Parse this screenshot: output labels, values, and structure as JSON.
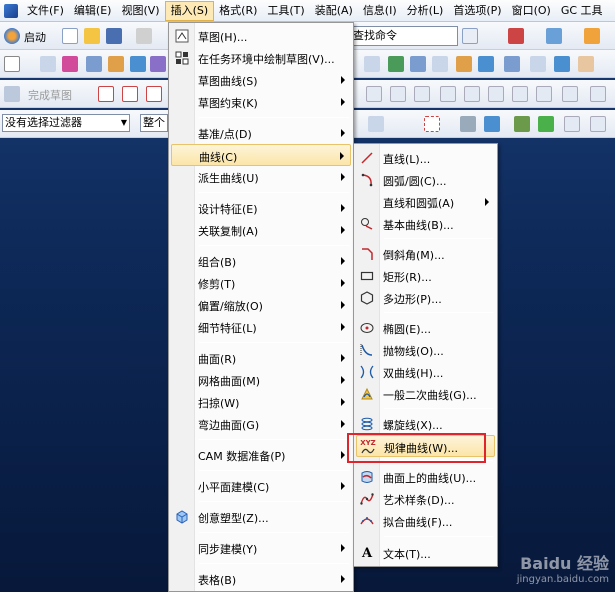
{
  "menubar": {
    "items": [
      "文件(F)",
      "编辑(E)",
      "视图(V)",
      "插入(S)",
      "格式(R)",
      "工具(T)",
      "装配(A)",
      "信息(I)",
      "分析(L)",
      "首选项(P)",
      "窗口(O)",
      "GC 工具"
    ]
  },
  "toolbar": {
    "start_label": "启动",
    "search_value": "查找命令",
    "finish_sketch_label": "完成草图",
    "selection_filter": "没有选择过滤器",
    "scope_value": "整个"
  },
  "insert_menu": {
    "items": [
      {
        "label": "草图(H)...",
        "icon": "sketch-icon",
        "submenu": false
      },
      {
        "label": "在任务环境中绘制草图(V)...",
        "icon": "sketch-task-icon",
        "submenu": false
      },
      {
        "label": "草图曲线(S)",
        "icon": "",
        "submenu": true
      },
      {
        "label": "草图约束(K)",
        "icon": "",
        "submenu": true
      },
      {
        "label": "基准/点(D)",
        "icon": "",
        "submenu": true
      },
      {
        "label": "曲线(C)",
        "icon": "",
        "submenu": true
      },
      {
        "label": "派生曲线(U)",
        "icon": "",
        "submenu": true
      },
      {
        "label": "设计特征(E)",
        "icon": "",
        "submenu": true
      },
      {
        "label": "关联复制(A)",
        "icon": "",
        "submenu": true
      },
      {
        "label": "组合(B)",
        "icon": "",
        "submenu": true
      },
      {
        "label": "修剪(T)",
        "icon": "",
        "submenu": true
      },
      {
        "label": "偏置/缩放(O)",
        "icon": "",
        "submenu": true
      },
      {
        "label": "细节特征(L)",
        "icon": "",
        "submenu": true
      },
      {
        "label": "曲面(R)",
        "icon": "",
        "submenu": true
      },
      {
        "label": "网格曲面(M)",
        "icon": "",
        "submenu": true
      },
      {
        "label": "扫掠(W)",
        "icon": "",
        "submenu": true
      },
      {
        "label": "弯边曲面(G)",
        "icon": "",
        "submenu": true
      },
      {
        "label": "CAM 数据准备(P)",
        "icon": "",
        "submenu": true
      },
      {
        "label": "小平面建模(C)",
        "icon": "",
        "submenu": true
      },
      {
        "label": "创意塑型(Z)...",
        "icon": "creative-modeling-icon",
        "submenu": false
      },
      {
        "label": "同步建模(Y)",
        "icon": "",
        "submenu": true
      },
      {
        "label": "表格(B)",
        "icon": "",
        "submenu": true
      }
    ]
  },
  "curve_menu": {
    "items": [
      {
        "label": "直线(L)...",
        "icon": "line-icon",
        "submenu": false
      },
      {
        "label": "圆弧/圆(C)...",
        "icon": "arc-icon",
        "submenu": false
      },
      {
        "label": "直线和圆弧(A)",
        "icon": "",
        "submenu": true
      },
      {
        "label": "基本曲线(B)...",
        "icon": "basic-curve-icon",
        "submenu": false
      },
      {
        "label": "倒斜角(M)...",
        "icon": "chamfer-icon",
        "submenu": false
      },
      {
        "label": "矩形(R)...",
        "icon": "rectangle-icon",
        "submenu": false
      },
      {
        "label": "多边形(P)...",
        "icon": "polygon-icon",
        "submenu": false
      },
      {
        "label": "椭圆(E)...",
        "icon": "ellipse-icon",
        "submenu": false
      },
      {
        "label": "抛物线(O)...",
        "icon": "parabola-icon",
        "submenu": false
      },
      {
        "label": "双曲线(H)...",
        "icon": "hyperbola-icon",
        "submenu": false
      },
      {
        "label": "一般二次曲线(G)...",
        "icon": "conic-icon",
        "submenu": false
      },
      {
        "label": "螺旋线(X)...",
        "icon": "helix-icon",
        "submenu": false
      },
      {
        "label": "规律曲线(W)...",
        "icon": "law-curve-icon",
        "submenu": false
      },
      {
        "label": "曲面上的曲线(U)...",
        "icon": "curve-on-surface-icon",
        "submenu": false
      },
      {
        "label": "艺术样条(D)...",
        "icon": "studio-spline-icon",
        "submenu": false
      },
      {
        "label": "拟合曲线(F)...",
        "icon": "fit-curve-icon",
        "submenu": false
      },
      {
        "label": "文本(T)...",
        "icon": "text-icon",
        "submenu": false
      }
    ]
  },
  "law_curve_icon_text": "XYZ",
  "text_icon_glyph": "A",
  "watermark": {
    "title": "Baidu 经验",
    "url": "jingyan.baidu.com"
  }
}
